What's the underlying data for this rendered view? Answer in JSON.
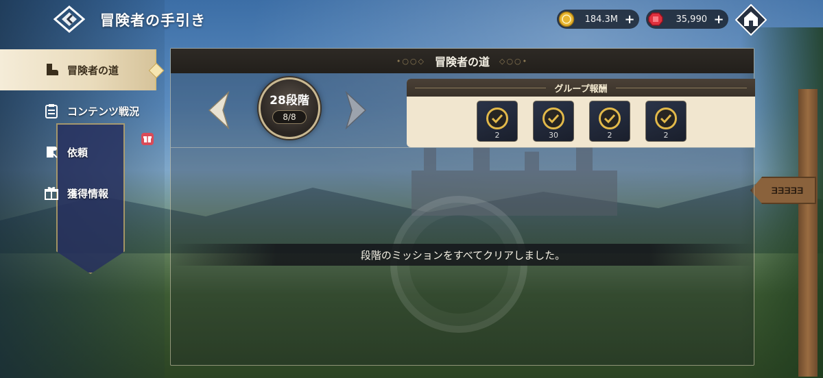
{
  "header": {
    "title": "冒険者の手引き",
    "back_icon": "diamond-back-icon",
    "home_icon": "home-icon"
  },
  "currencies": [
    {
      "name": "gold",
      "icon": "gold-coin-icon",
      "value": "184.3M",
      "color": "#e6b531"
    },
    {
      "name": "gem",
      "icon": "red-gem-icon",
      "value": "35,990",
      "color": "#e0303e"
    }
  ],
  "sidebar": {
    "items": [
      {
        "label": "冒険者の道",
        "icon": "boot-icon",
        "active": true
      },
      {
        "label": "コンテンツ戦況",
        "icon": "clipboard-icon",
        "active": false
      },
      {
        "label": "依頼",
        "icon": "scroll-icon",
        "active": false,
        "badge": "gift-badge-icon"
      },
      {
        "label": "獲得情報",
        "icon": "gift-icon",
        "active": false
      }
    ]
  },
  "panel": {
    "title": "冒険者の道",
    "stage": {
      "label": "28段階",
      "progress": "8/8"
    },
    "group_reward": {
      "title": "グループ報酬",
      "items": [
        {
          "icon": "purple-gem-reward-icon",
          "qty": "2",
          "claimed": true
        },
        {
          "icon": "ticket-reward-icon",
          "qty": "30",
          "claimed": true
        },
        {
          "icon": "crystal-reward-icon",
          "qty": "2",
          "claimed": true
        },
        {
          "icon": "red-orb-reward-icon",
          "qty": "2",
          "claimed": true
        }
      ]
    },
    "message": "段階のミッションをすべてクリアしました。"
  },
  "scenery": {
    "sign_text": "ƎƎƎƎƎ"
  },
  "colors": {
    "accent_gold": "#d7be7c",
    "panel_cream": "#f1e6cf",
    "check_gold": "#e2b94a"
  }
}
